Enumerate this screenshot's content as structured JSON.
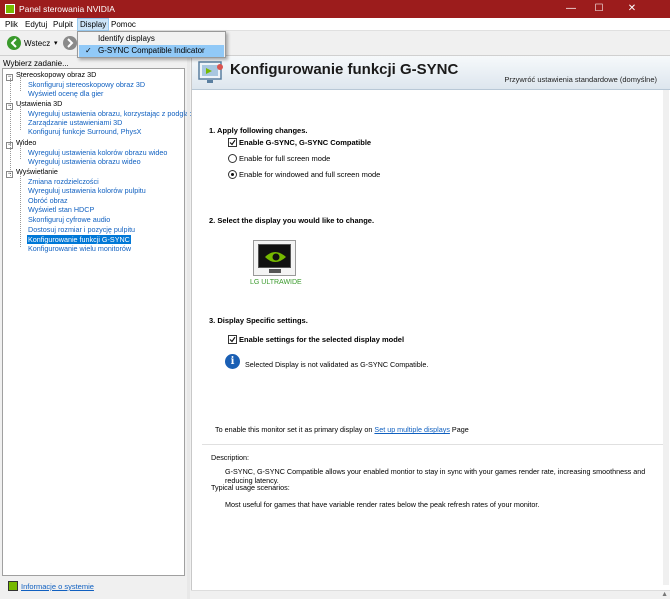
{
  "window": {
    "title": "Panel sterowania NVIDIA",
    "minimize": "—",
    "maximize": "☐",
    "close": "✕"
  },
  "menu": {
    "items": [
      "Plik",
      "Edytuj",
      "Pulpit",
      "Display",
      "Pomoc"
    ],
    "active": "Display"
  },
  "toolbar": {
    "back_label": "Wstecz",
    "dropdown_glyph": "▾"
  },
  "display_menu": {
    "items": [
      {
        "label": "Identify displays",
        "checked": false
      },
      {
        "label": "G-SYNC Compatible Indicator",
        "checked": true,
        "check_glyph": "✓"
      }
    ]
  },
  "left_panel": {
    "label": "Wybierz zadanie...",
    "categories": [
      {
        "label": "Stereoskopowy obraz 3D",
        "toggle": "−",
        "items": [
          "Skonfiguruj stereoskopowy obraz 3D",
          "Wyświetl ocenę dla gier"
        ]
      },
      {
        "label": "Ustawienia 3D",
        "toggle": "−",
        "items": [
          "Wyreguluj ustawienia obrazu, korzystając z podglądu",
          "Zarządzanie ustawieniami 3D",
          "Konfiguruj funkcje Surround, PhysX"
        ]
      },
      {
        "label": "Wideo",
        "toggle": "−",
        "items": [
          "Wyreguluj ustawienia kolorów obrazu wideo",
          "Wyreguluj ustawienia obrazu wideo"
        ]
      },
      {
        "label": "Wyświetlanie",
        "toggle": "−",
        "items": [
          "Zmiana rozdzielczości",
          "Wyreguluj ustawienia kolorów pulpitu",
          "Obróć obraz",
          "Wyświetl stan HDCP",
          "Skonfiguruj cyfrowe audio",
          "Dostosuj rozmiar i pozycję pulpitu",
          "Konfigurowanie funkcji G-SYNC",
          "Konfigurowanie wielu monitorów"
        ]
      }
    ],
    "selected": "Konfigurowanie funkcji G-SYNC",
    "system_info": "Informacje o systemie"
  },
  "content": {
    "title": "Konfigurowanie funkcji G-SYNC",
    "restore_defaults": "Przywróć ustawienia standardowe (domyślne)",
    "section1": {
      "heading": "1. Apply following changes.",
      "enable_label": "Enable G-SYNC, G-SYNC Compatible",
      "enable_checked": true,
      "radio_full": "Enable for full screen mode",
      "radio_windowed": "Enable for windowed and full screen mode",
      "selected_radio": "windowed"
    },
    "section2": {
      "heading": "2. Select the display you would like to change.",
      "display_name": "LG ULTRAWIDE"
    },
    "section3": {
      "heading": "3. Display Specific settings.",
      "enable_label": "Enable settings for the selected display model",
      "enable_checked": true,
      "info_glyph": "i",
      "info_text": "Selected Display is not validated as G-SYNC Compatible."
    },
    "primary": {
      "prefix": "To enable this monitor set it as primary display on",
      "link": "Set up multiple displays",
      "suffix": "Page"
    },
    "description": {
      "label": "Description:",
      "text": "G-SYNC, G-SYNC Compatible allows your enabled montior to stay in sync with your games render rate, increasing smoothness and reducing latency.",
      "usage_label": "Typical usage scenarios:",
      "usage_text": "Most useful for games that have variable render rates below the peak refresh rates of your monitor."
    }
  },
  "colors": {
    "titlebar": "#9c1c1c",
    "nvidia_green": "#76b900",
    "link": "#1060c0",
    "selection": "#0078d7",
    "menu_highlight": "#91c9f7"
  }
}
